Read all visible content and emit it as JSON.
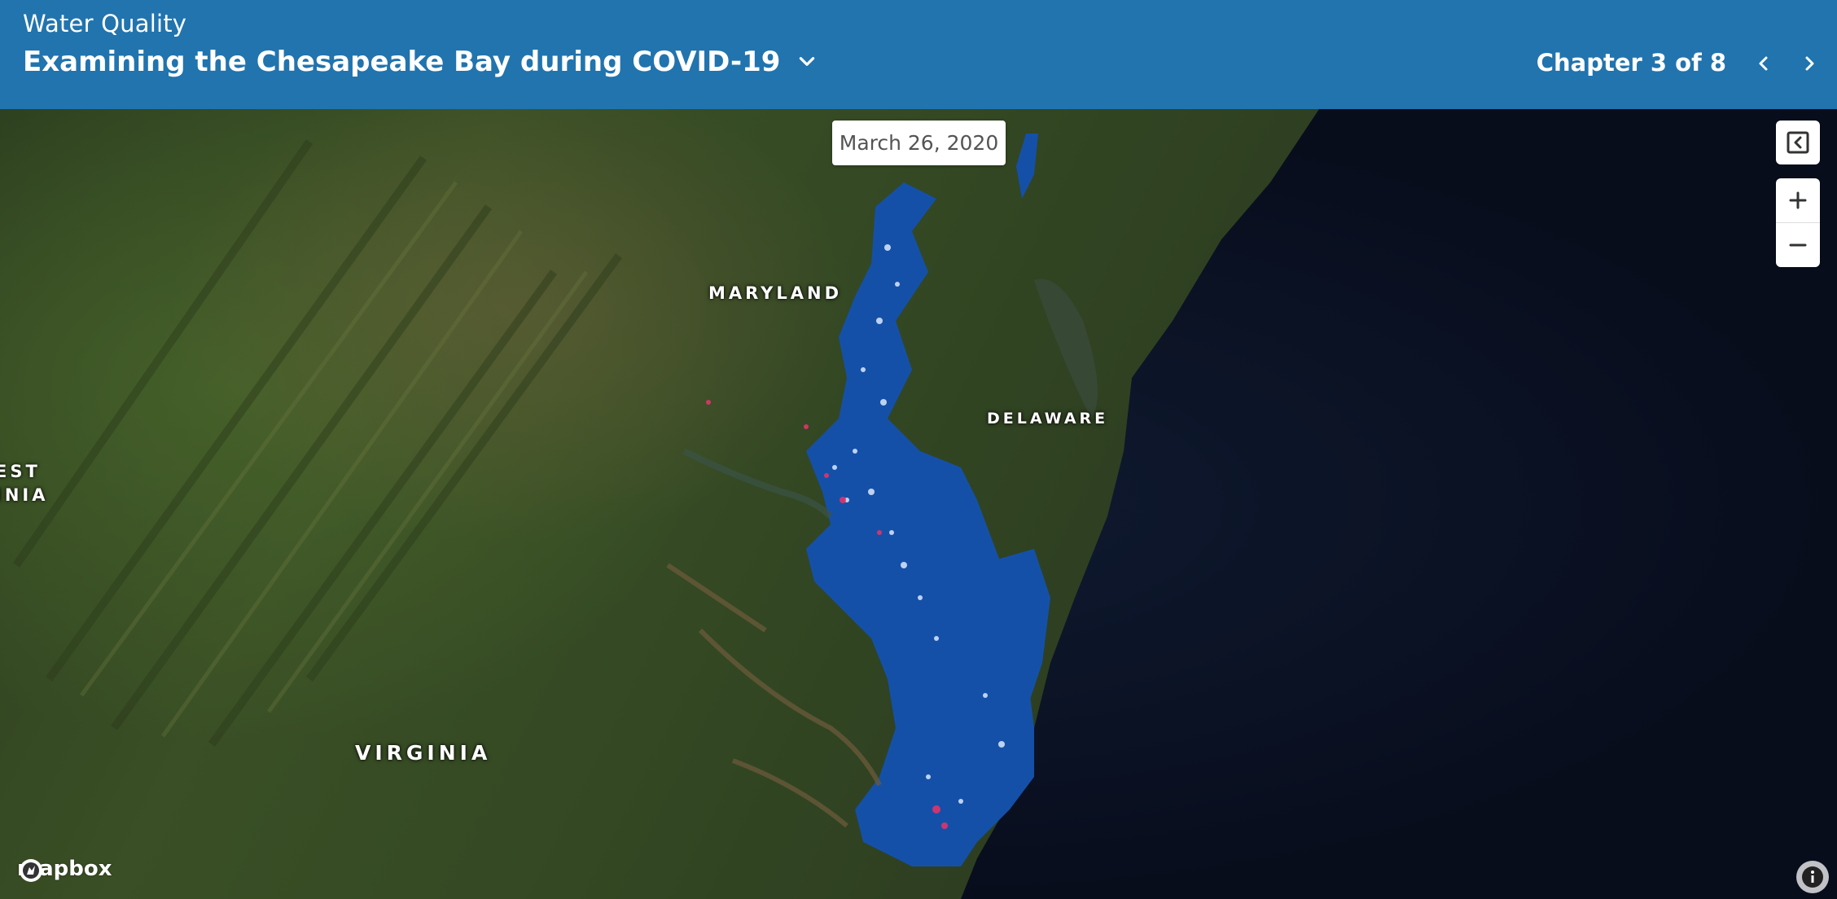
{
  "header": {
    "kicker": "Water Quality",
    "title": "Examining the Chesapeake Bay during COVID-19",
    "chapter_label": "Chapter 3 of 8"
  },
  "map": {
    "date": "March 26, 2020",
    "labels": {
      "maryland": "MARYLAND",
      "delaware": "DELAWARE",
      "virginia": "VIRGINIA",
      "west_virginia_line1": "EST",
      "west_virginia_line2": "INIA"
    },
    "attribution_logo": "mapbox"
  },
  "icons": {
    "title_dropdown": "chevron-down-icon",
    "prev": "chevron-left-icon",
    "next": "chevron-right-icon",
    "collapse": "collapse-panel-icon",
    "zoom_in": "plus-icon",
    "zoom_out": "minus-icon",
    "info": "info-icon",
    "logo": "mapbox-logo-icon"
  },
  "colors": {
    "header_bg": "#2174ae",
    "water_overlay": "#1550a8",
    "ocean": "#0b1224"
  }
}
